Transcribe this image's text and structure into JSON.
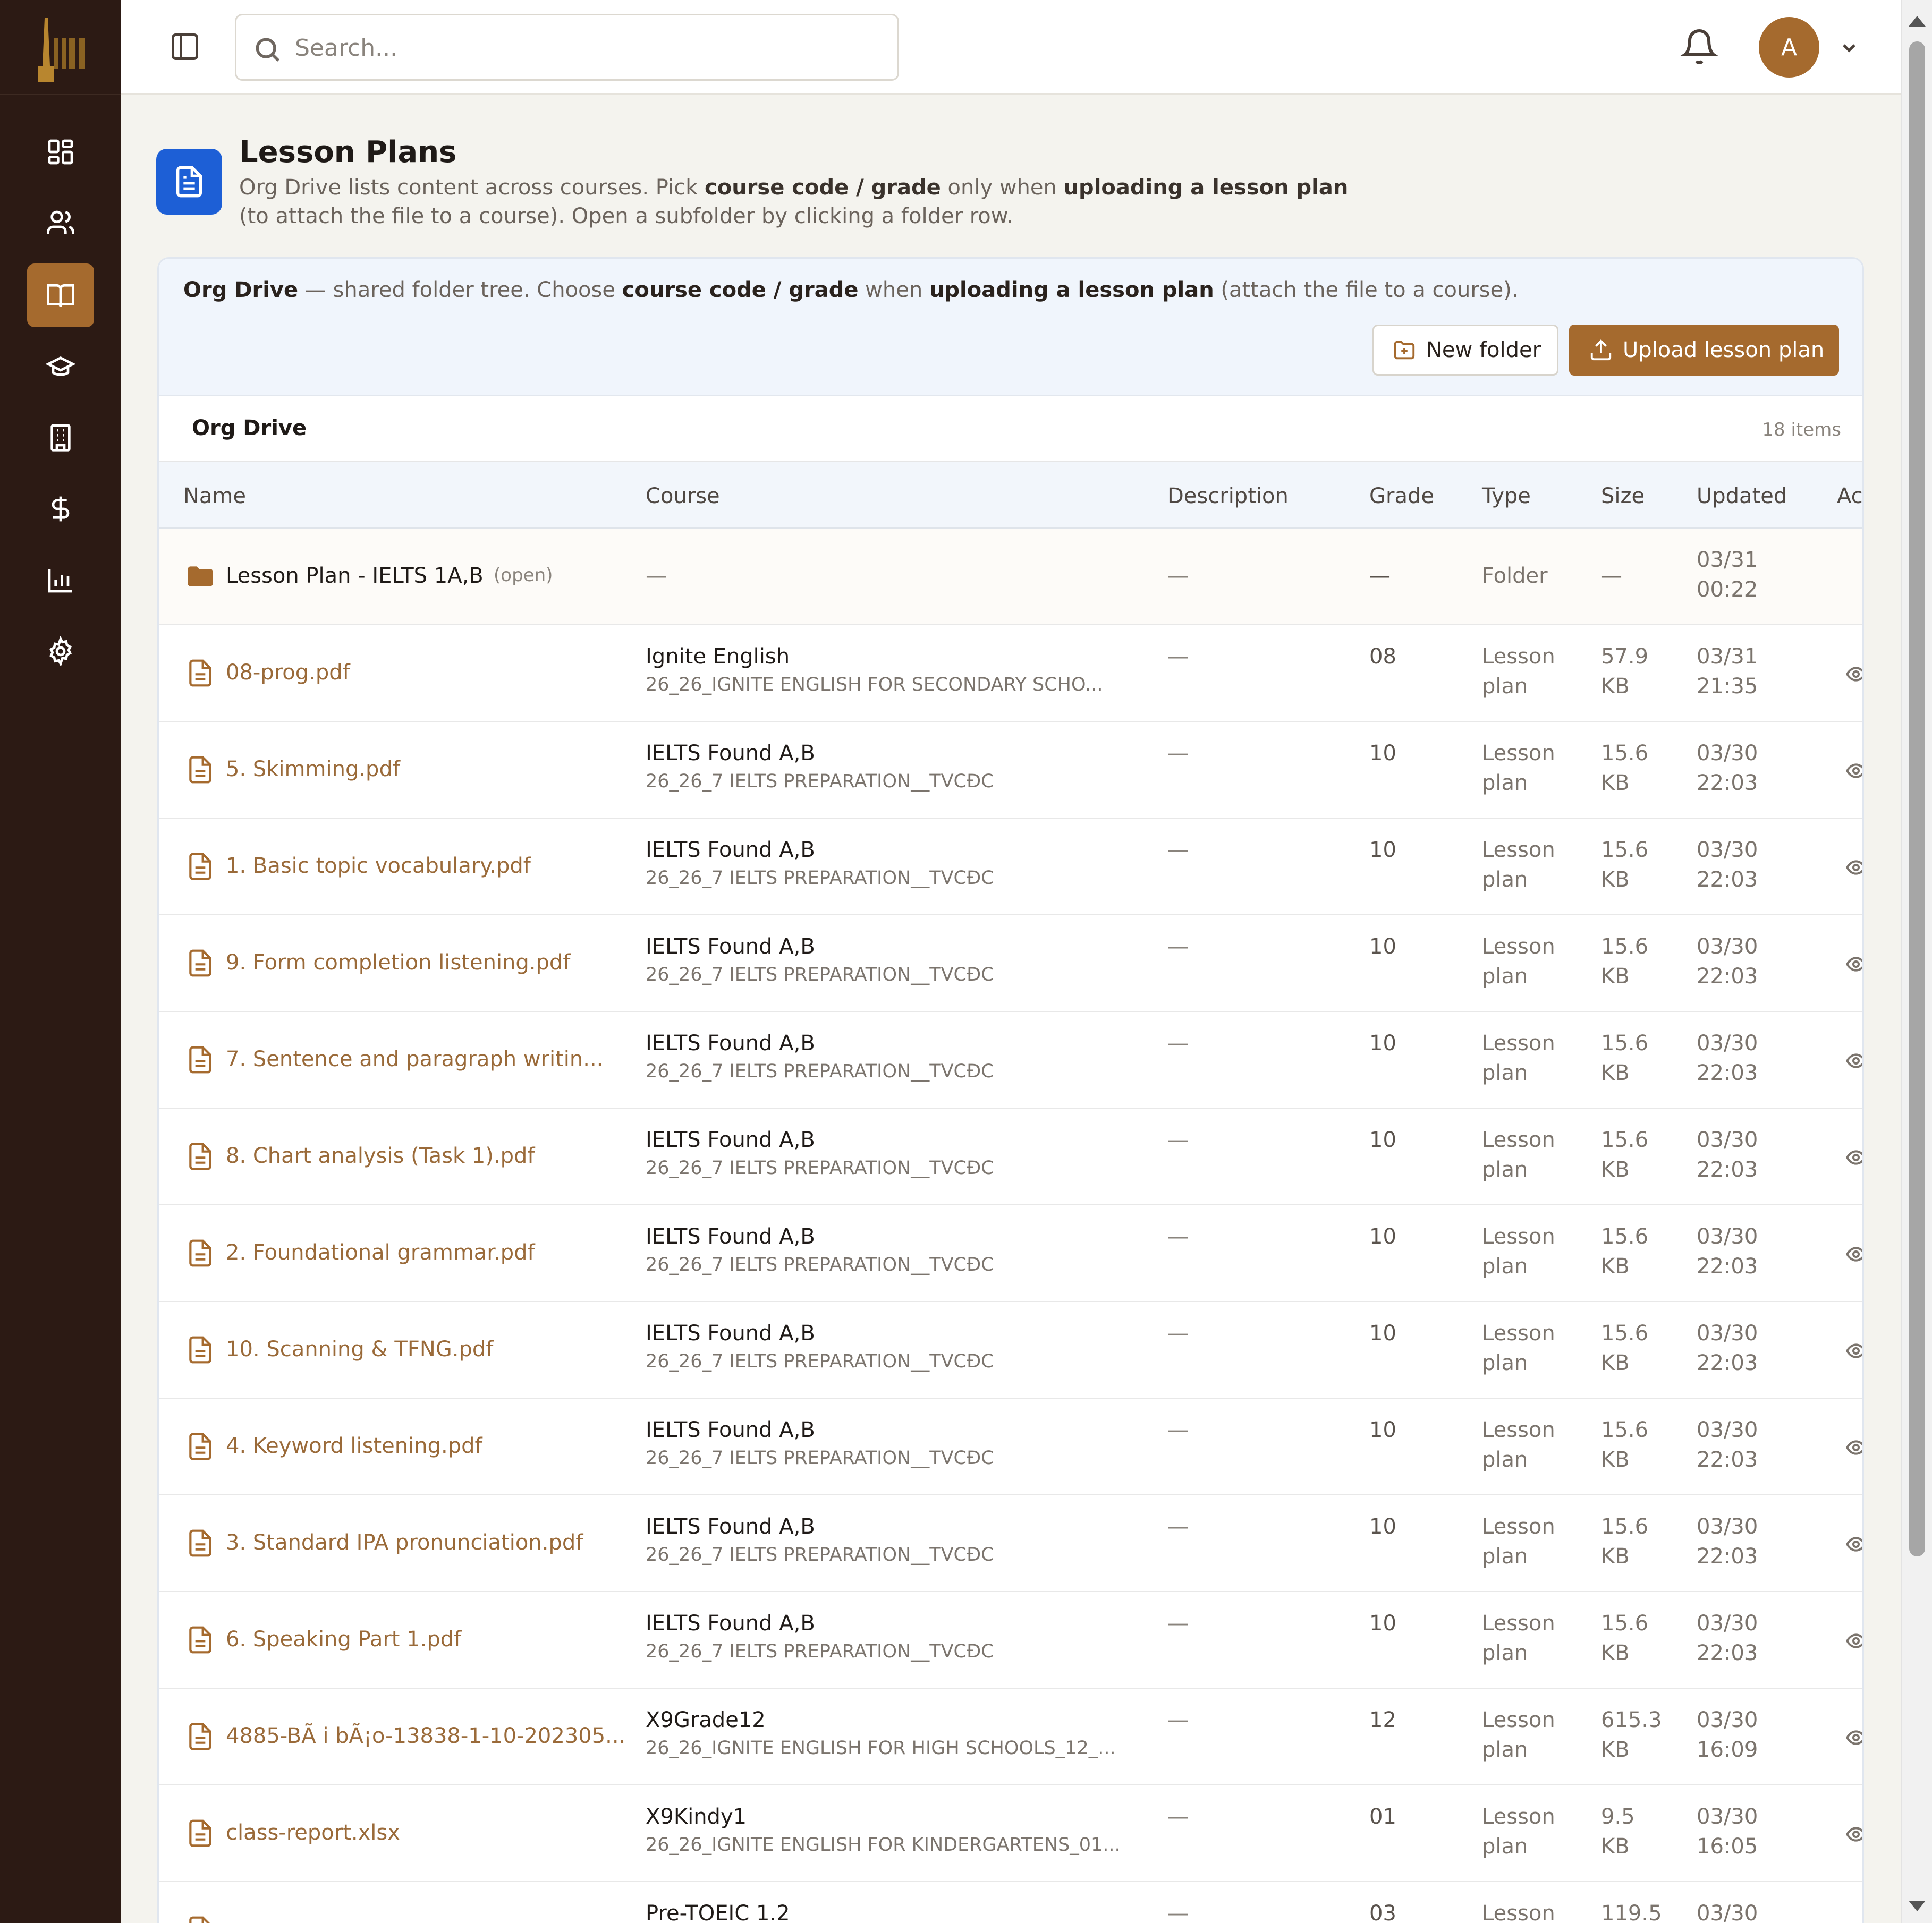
{
  "colors": {
    "sidebar_bg": "#2c1a14",
    "accent": "#a56a2e",
    "page_icon_blue": "#1d5fd6",
    "card_header_bg": "#f0f5fc",
    "file_name": "#9a6a39"
  },
  "logo_text": "ISEE",
  "sidebar": {
    "items": [
      {
        "icon": "dashboard-icon"
      },
      {
        "icon": "users-icon"
      },
      {
        "icon": "book-open-icon",
        "active": true
      },
      {
        "icon": "graduation-cap-icon"
      },
      {
        "icon": "building-icon"
      },
      {
        "icon": "dollar-icon"
      },
      {
        "icon": "bar-chart-icon"
      },
      {
        "icon": "settings-icon"
      }
    ]
  },
  "topbar": {
    "search_placeholder": "Search...",
    "avatar_initial": "A"
  },
  "page": {
    "title": "Lesson Plans",
    "subtitle_parts": [
      "Org Drive lists content across courses. Pick ",
      "course code / grade",
      " only when ",
      "uploading a lesson plan",
      " (to attach the file to a course). Open a subfolder by clicking a folder row."
    ]
  },
  "card": {
    "info_parts": [
      "Org Drive",
      " — shared folder tree. Choose ",
      "course code / grade",
      " when ",
      "uploading a lesson plan",
      " (attach the file to a course)."
    ],
    "new_folder_label": "New folder",
    "upload_label": "Upload lesson plan",
    "drive_title": "Org Drive",
    "item_count": "18 items"
  },
  "table": {
    "headers": {
      "name": "Name",
      "course": "Course",
      "description": "Description",
      "grade": "Grade",
      "type": "Type",
      "size": "Size",
      "updated": "Updated",
      "actions": "Ac"
    },
    "folder_row": {
      "name": "Lesson Plan - IELTS 1A,B",
      "tag": "(open)",
      "course": "—",
      "description": "—",
      "grade": "—",
      "type": "Folder",
      "size": "—",
      "updated_date": "03/31",
      "updated_time": "00:22"
    },
    "rows": [
      {
        "name": "08-prog.pdf",
        "course": "Ignite English",
        "course_code": "26_26_IGNITE ENGLISH FOR SECONDARY SCHO...",
        "description": "—",
        "grade": "08",
        "type1": "Lesson",
        "type2": "plan",
        "size1": "57.9",
        "size2": "KB",
        "date": "03/31",
        "time": "21:35"
      },
      {
        "name": "5. Skimming.pdf",
        "course": "IELTS Found A,B",
        "course_code": "26_26_7 IELTS PREPARATION__TVCĐC",
        "description": "—",
        "grade": "10",
        "type1": "Lesson",
        "type2": "plan",
        "size1": "15.6",
        "size2": "KB",
        "date": "03/30",
        "time": "22:03"
      },
      {
        "name": "1. Basic topic vocabulary.pdf",
        "course": "IELTS Found A,B",
        "course_code": "26_26_7 IELTS PREPARATION__TVCĐC",
        "description": "—",
        "grade": "10",
        "type1": "Lesson",
        "type2": "plan",
        "size1": "15.6",
        "size2": "KB",
        "date": "03/30",
        "time": "22:03"
      },
      {
        "name": "9. Form completion listening.pdf",
        "course": "IELTS Found A,B",
        "course_code": "26_26_7 IELTS PREPARATION__TVCĐC",
        "description": "—",
        "grade": "10",
        "type1": "Lesson",
        "type2": "plan",
        "size1": "15.6",
        "size2": "KB",
        "date": "03/30",
        "time": "22:03"
      },
      {
        "name": "7. Sentence and paragraph writin...",
        "course": "IELTS Found A,B",
        "course_code": "26_26_7 IELTS PREPARATION__TVCĐC",
        "description": "—",
        "grade": "10",
        "type1": "Lesson",
        "type2": "plan",
        "size1": "15.6",
        "size2": "KB",
        "date": "03/30",
        "time": "22:03"
      },
      {
        "name": "8. Chart analysis (Task 1).pdf",
        "course": "IELTS Found A,B",
        "course_code": "26_26_7 IELTS PREPARATION__TVCĐC",
        "description": "—",
        "grade": "10",
        "type1": "Lesson",
        "type2": "plan",
        "size1": "15.6",
        "size2": "KB",
        "date": "03/30",
        "time": "22:03"
      },
      {
        "name": "2. Foundational grammar.pdf",
        "course": "IELTS Found A,B",
        "course_code": "26_26_7 IELTS PREPARATION__TVCĐC",
        "description": "—",
        "grade": "10",
        "type1": "Lesson",
        "type2": "plan",
        "size1": "15.6",
        "size2": "KB",
        "date": "03/30",
        "time": "22:03"
      },
      {
        "name": "10. Scanning & TFNG.pdf",
        "course": "IELTS Found A,B",
        "course_code": "26_26_7 IELTS PREPARATION__TVCĐC",
        "description": "—",
        "grade": "10",
        "type1": "Lesson",
        "type2": "plan",
        "size1": "15.6",
        "size2": "KB",
        "date": "03/30",
        "time": "22:03"
      },
      {
        "name": "4. Keyword listening.pdf",
        "course": "IELTS Found A,B",
        "course_code": "26_26_7 IELTS PREPARATION__TVCĐC",
        "description": "—",
        "grade": "10",
        "type1": "Lesson",
        "type2": "plan",
        "size1": "15.6",
        "size2": "KB",
        "date": "03/30",
        "time": "22:03"
      },
      {
        "name": "3. Standard IPA pronunciation.pdf",
        "course": "IELTS Found A,B",
        "course_code": "26_26_7 IELTS PREPARATION__TVCĐC",
        "description": "—",
        "grade": "10",
        "type1": "Lesson",
        "type2": "plan",
        "size1": "15.6",
        "size2": "KB",
        "date": "03/30",
        "time": "22:03"
      },
      {
        "name": "6. Speaking Part 1.pdf",
        "course": "IELTS Found A,B",
        "course_code": "26_26_7 IELTS PREPARATION__TVCĐC",
        "description": "—",
        "grade": "10",
        "type1": "Lesson",
        "type2": "plan",
        "size1": "15.6",
        "size2": "KB",
        "date": "03/30",
        "time": "22:03"
      },
      {
        "name": "4885-BÃ i bÃ¡o-13838-1-10-202305...",
        "course": "X9Grade12",
        "course_code": "26_26_IGNITE ENGLISH FOR HIGH SCHOOLS_12_...",
        "description": "—",
        "grade": "12",
        "type1": "Lesson",
        "type2": "plan",
        "size1": "615.3",
        "size2": "KB",
        "date": "03/30",
        "time": "16:09"
      },
      {
        "name": "class-report.xlsx",
        "course": "X9Kindy1",
        "course_code": "26_26_IGNITE ENGLISH FOR KINDERGARTENS_01...",
        "description": "—",
        "grade": "01",
        "type1": "Lesson",
        "type2": "plan",
        "size1": "9.5",
        "size2": "KB",
        "date": "03/30",
        "time": "16:05"
      },
      {
        "name": "",
        "course": "Pre-TOEIC 1.2",
        "course_code": "",
        "description": "—",
        "grade": "03",
        "type1": "Lesson",
        "type2": "",
        "size1": "119.5",
        "size2": "",
        "date": "03/30",
        "time": ""
      }
    ]
  }
}
